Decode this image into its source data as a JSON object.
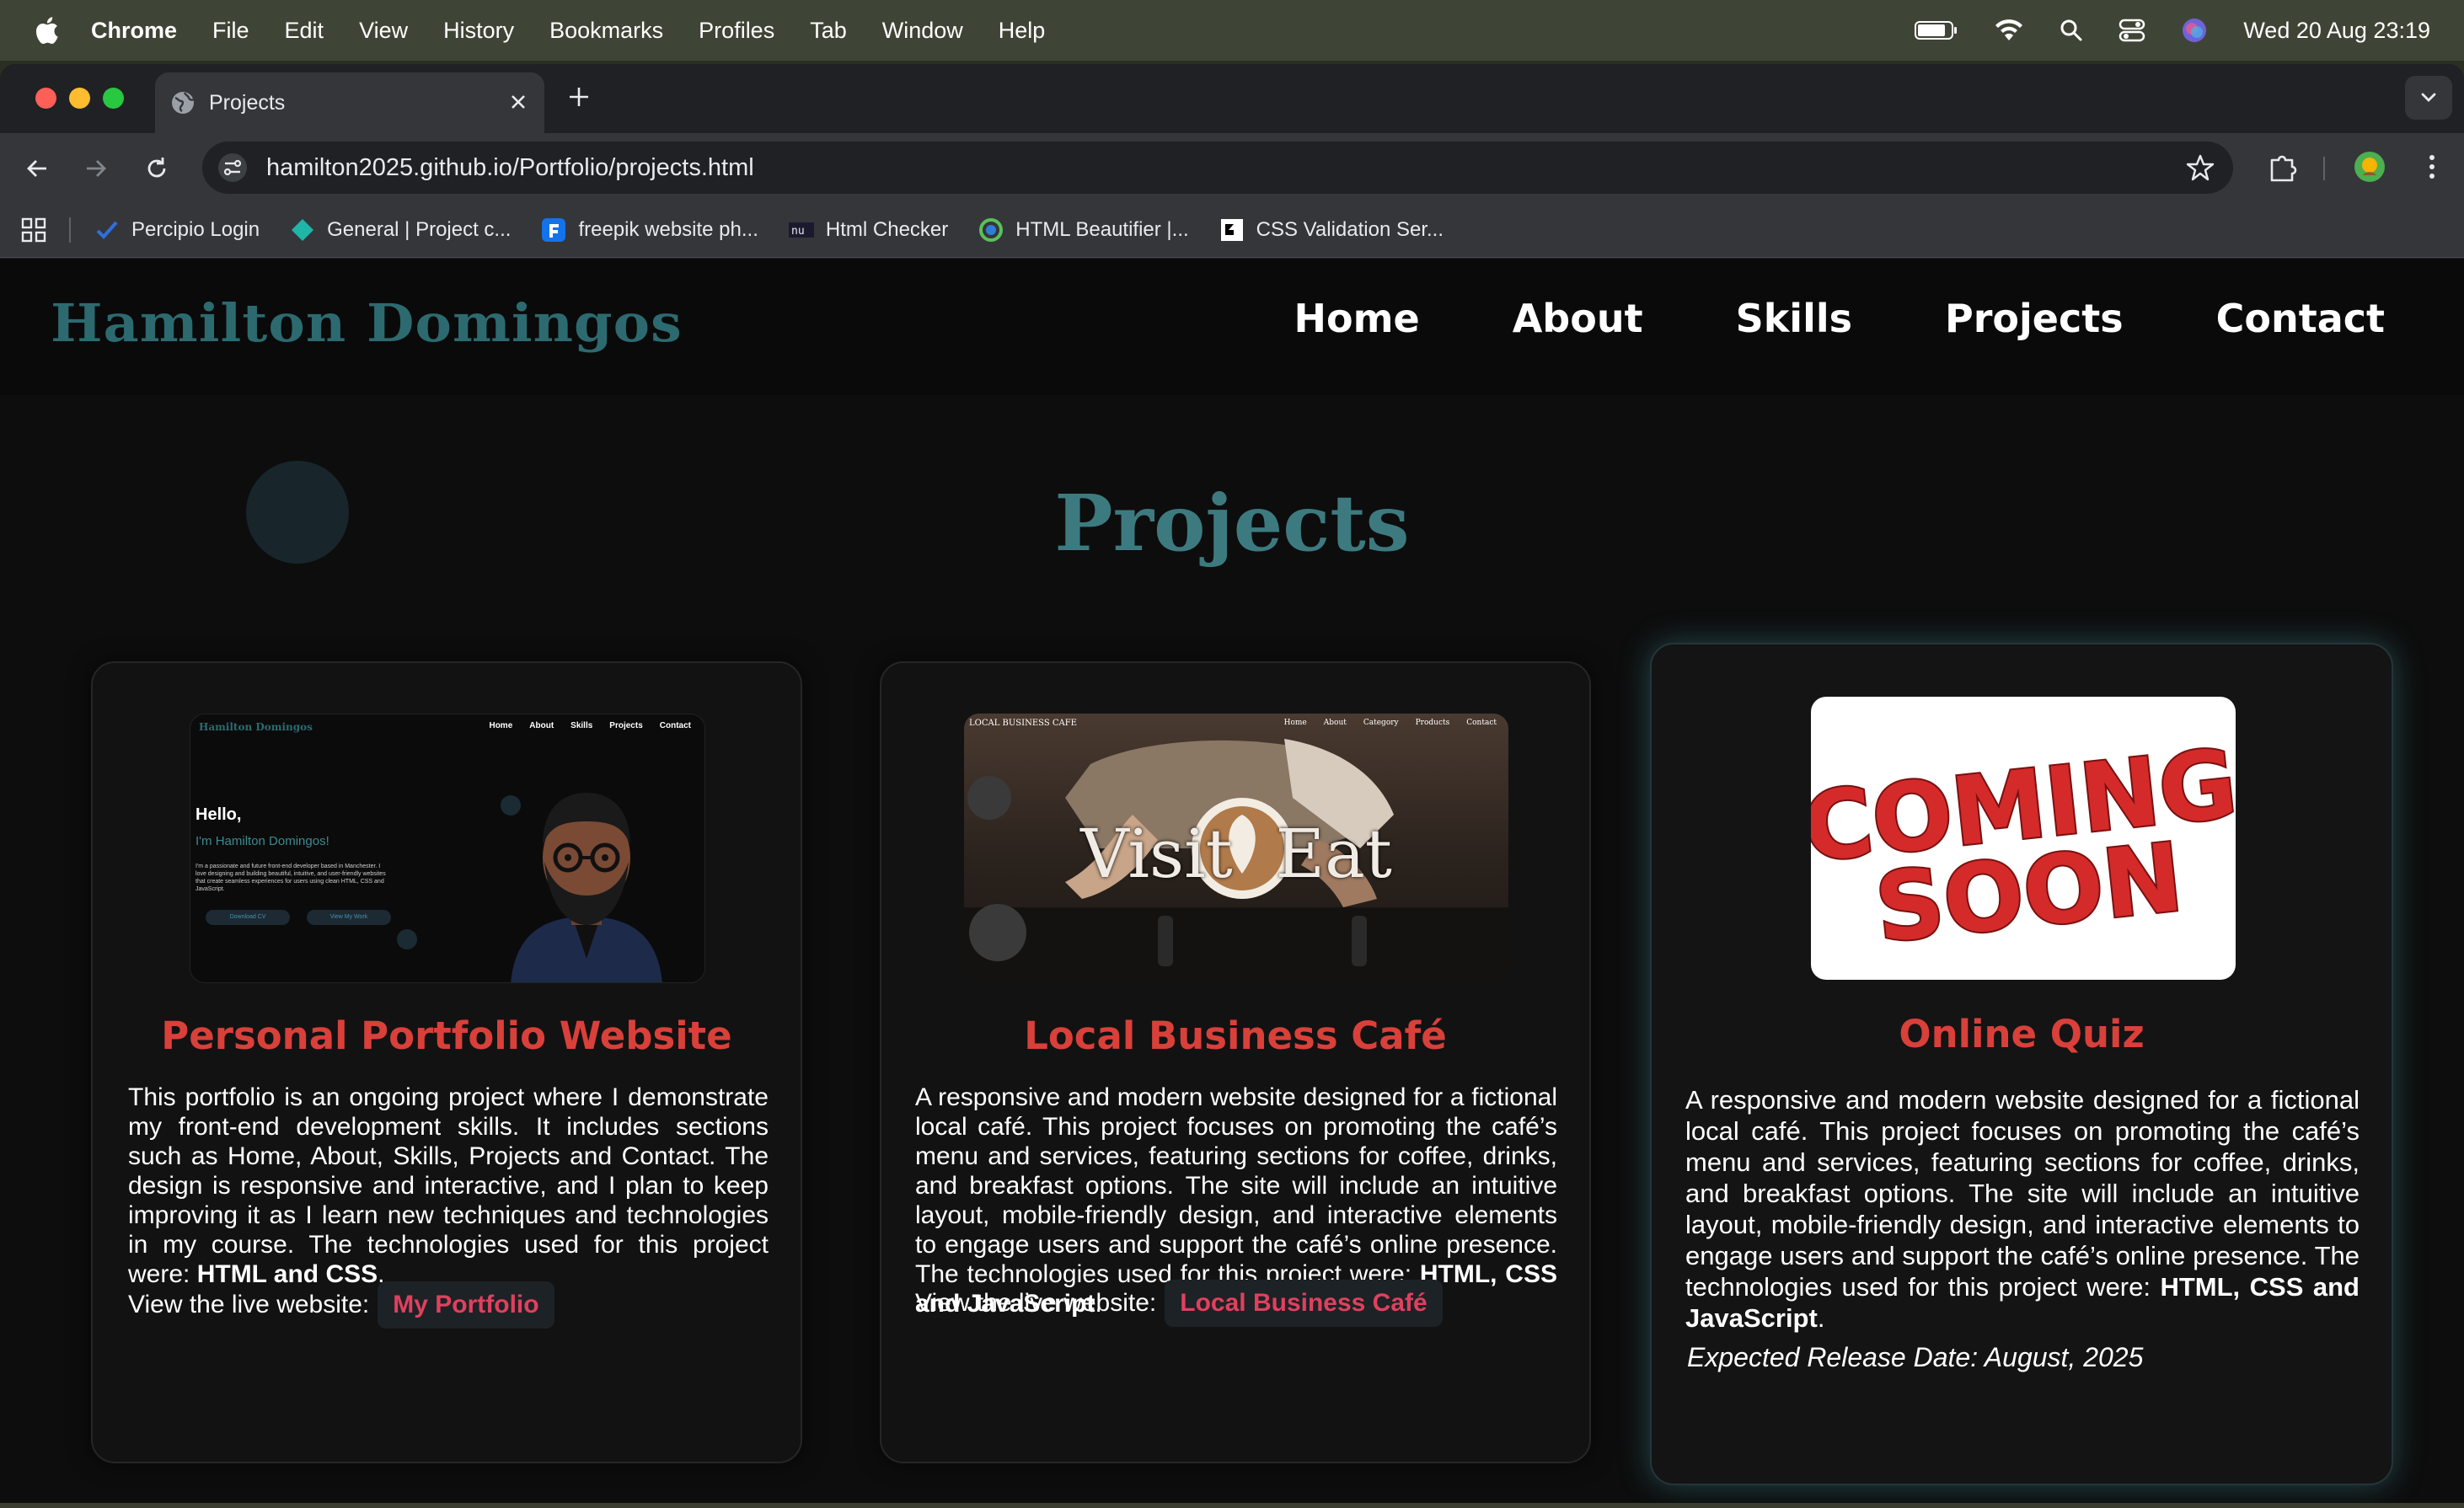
{
  "menubar": {
    "app": "Chrome",
    "items": [
      "File",
      "Edit",
      "View",
      "History",
      "Bookmarks",
      "Profiles",
      "Tab",
      "Window",
      "Help"
    ],
    "datetime": "Wed 20 Aug  23:19"
  },
  "browser": {
    "tab_title": "Projects",
    "url": "hamilton2025.github.io/Portfolio/projects.html",
    "bookmarks": [
      {
        "label": "Percipio Login",
        "icon": "check-icon"
      },
      {
        "label": "General | Project c...",
        "icon": "diamond-icon"
      },
      {
        "label": "freepik website ph...",
        "icon": "freepik-icon"
      },
      {
        "label": "Html Checker",
        "icon": "nu-icon"
      },
      {
        "label": "HTML Beautifier |...",
        "icon": "beautifier-icon"
      },
      {
        "label": "CSS Validation Ser...",
        "icon": "w3c-icon"
      }
    ]
  },
  "site": {
    "logo": "Hamilton Domingos",
    "nav": [
      "Home",
      "About",
      "Skills",
      "Projects",
      "Contact"
    ],
    "page_title": "Projects",
    "live_prefix": "View the live website:",
    "projects": [
      {
        "title": "Personal Portfolio Website",
        "desc_main": "This portfolio is an ongoing project where I demonstrate my front-end development skills. It includes sections such as Home, About, Skills, Projects and Contact. The design is responsive and interactive, and I plan to keep improving it as I learn new techniques and technologies in my course. The technologies used for this project were: ",
        "desc_tech": "HTML and CSS",
        "desc_end": ".",
        "link": "My Portfolio",
        "thumb": {
          "logo": "Hamilton Domingos",
          "nav": [
            "Home",
            "About",
            "Skills",
            "Projects",
            "Contact"
          ],
          "hello": "Hello,",
          "name": "I'm Hamilton Domingos!",
          "blurb": "I'm a passionate and future front-end developer based in Manchester. I love designing and building beautiful, intuitive, and user-friendly websites that create seamless experiences for users using clean HTML, CSS and JavaScript.",
          "btn1": "Download CV",
          "btn2": "View My Work"
        }
      },
      {
        "title": "Local Business Café",
        "desc_main": "A responsive and modern website designed for a fictional local café. This project focuses on promoting the café’s menu and services, featuring sections for coffee, drinks, and breakfast options. The site will include an intuitive layout, mobile-friendly design, and interactive elements to engage users and support the café’s online presence. The technologies used for this project were: ",
        "desc_tech": "HTML, CSS and JavaScript",
        "desc_end": ".",
        "link": "Local Business Café",
        "thumb": {
          "brand": "LOCAL BUSINESS CAFE",
          "nav": [
            "Home",
            "About",
            "Category",
            "Products",
            "Contact"
          ],
          "hero": "Visit  Eat"
        }
      },
      {
        "title": "Online Quiz",
        "desc_main": "A responsive and modern website designed for a fictional local café. This project focuses on promoting the café’s menu and services, featuring sections for coffee, drinks, and breakfast options. The site will include an intuitive layout, mobile-friendly design, and interactive elements to engage users and support the café’s online presence. The technologies used for this project were: ",
        "desc_tech": "HTML, CSS and JavaScript",
        "desc_end": ".",
        "release": "Expected Release Date: August, 2025",
        "thumb": {
          "line1": "COMING",
          "line2": "SOON"
        }
      }
    ]
  },
  "colors": {
    "accent_teal": "#3d7a80",
    "title_red": "#d9403a",
    "link_pink": "#e0405e",
    "page_bg": "#0d0d0d"
  }
}
